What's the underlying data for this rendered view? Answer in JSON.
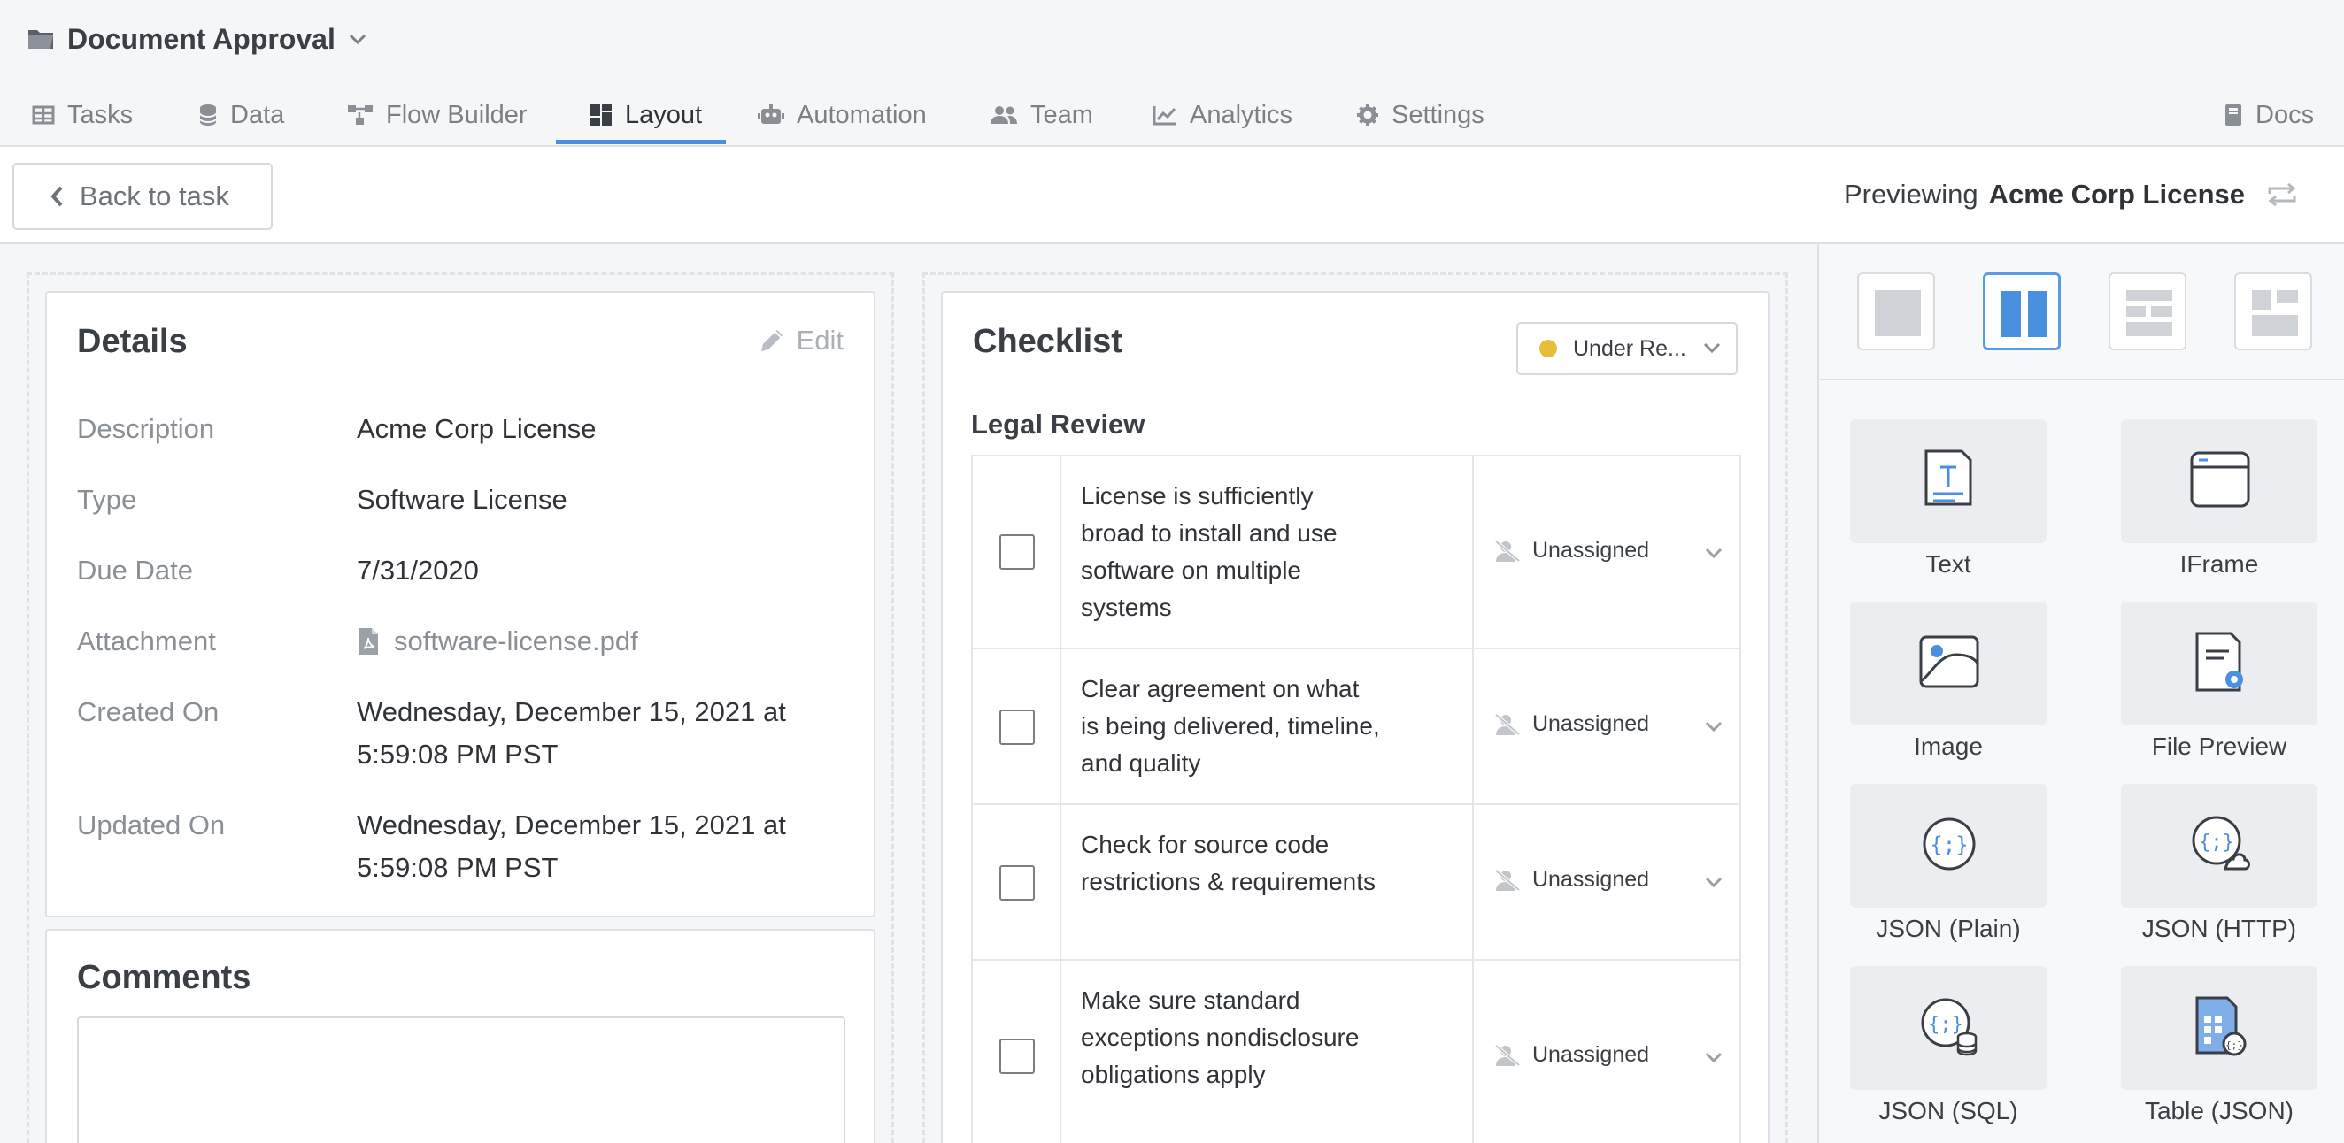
{
  "app": {
    "title": "Document Approval"
  },
  "tabs": [
    {
      "label": "Tasks",
      "icon": "table-icon"
    },
    {
      "label": "Data",
      "icon": "database-icon"
    },
    {
      "label": "Flow Builder",
      "icon": "flow-icon"
    },
    {
      "label": "Layout",
      "icon": "layout-icon",
      "active": true
    },
    {
      "label": "Automation",
      "icon": "robot-icon"
    },
    {
      "label": "Team",
      "icon": "users-icon"
    },
    {
      "label": "Analytics",
      "icon": "chart-icon"
    },
    {
      "label": "Settings",
      "icon": "gear-icon"
    },
    {
      "label": "Docs",
      "icon": "book-icon"
    }
  ],
  "toolbar": {
    "back_label": "Back to task",
    "previewing_prefix": "Previewing",
    "previewing_name": "Acme Corp License"
  },
  "details": {
    "title": "Details",
    "edit_label": "Edit",
    "rows": [
      {
        "label": "Description",
        "value": "Acme Corp License"
      },
      {
        "label": "Type",
        "value": "Software License"
      },
      {
        "label": "Due Date",
        "value": "7/31/2020"
      },
      {
        "label": "Attachment",
        "value": "software-license.pdf"
      },
      {
        "label": "Created On",
        "value": "Wednesday, December 15, 2021 at 5:59:08 PM PST"
      },
      {
        "label": "Updated On",
        "value": "Wednesday, December 15, 2021 at 5:59:08 PM PST"
      }
    ]
  },
  "comments": {
    "title": "Comments"
  },
  "checklist": {
    "title": "Checklist",
    "status": "Under Re...",
    "status_color": "#e6be3c",
    "section": "Legal Review",
    "items": [
      {
        "text": "License is sufficiently broad to install and use software on multiple systems",
        "assignee": "Unassigned",
        "checked": false
      },
      {
        "text": "Clear agreement on what is being delivered, timeline, and quality",
        "assignee": "Unassigned",
        "checked": false
      },
      {
        "text": "Check for source code restrictions & requirements",
        "assignee": "Unassigned",
        "checked": false
      },
      {
        "text": "Make sure standard exceptions nondisclosure obligations apply",
        "assignee": "Unassigned",
        "checked": false
      }
    ]
  },
  "sidebar": {
    "layouts": [
      "single-column",
      "two-column",
      "rows",
      "grid"
    ],
    "selected_layout": "two-column",
    "widgets": [
      {
        "label": "Text",
        "icon": "text-doc-icon"
      },
      {
        "label": "IFrame",
        "icon": "browser-window-icon"
      },
      {
        "label": "Image",
        "icon": "image-icon"
      },
      {
        "label": "File Preview",
        "icon": "file-preview-icon"
      },
      {
        "label": "JSON (Plain)",
        "icon": "json-icon"
      },
      {
        "label": "JSON (HTTP)",
        "icon": "json-cloud-icon"
      },
      {
        "label": "JSON (SQL)",
        "icon": "json-database-icon"
      },
      {
        "label": "Table (JSON)",
        "icon": "table-json-icon"
      }
    ]
  },
  "colors": {
    "accent": "#4a8fe0",
    "status_yellow": "#e6be3c"
  }
}
